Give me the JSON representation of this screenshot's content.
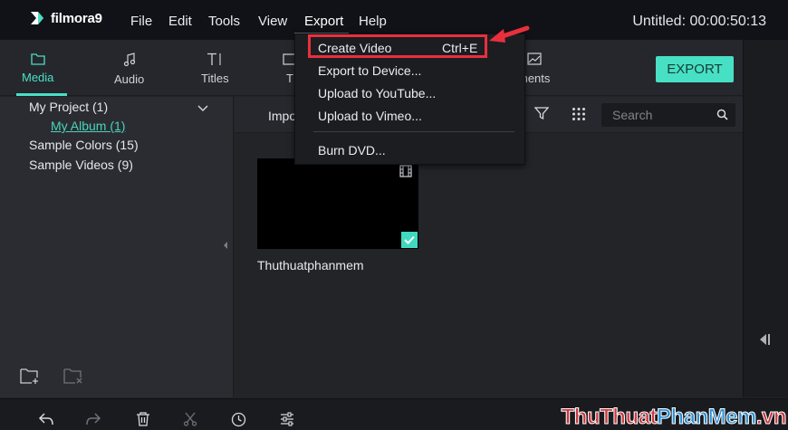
{
  "app": {
    "logo_text": "filmora9",
    "window_title": "Untitled: 00:00:50:13"
  },
  "menubar": {
    "items": [
      "File",
      "Edit",
      "Tools",
      "View",
      "Export",
      "Help"
    ]
  },
  "tabs": [
    {
      "label": "Media",
      "icon": "folder-icon"
    },
    {
      "label": "Audio",
      "icon": "music-note-icon"
    },
    {
      "label": "Titles",
      "icon": "text-icon"
    },
    {
      "label": "T",
      "icon": "transition-icon"
    },
    {
      "label": "ments",
      "icon": "elements-icon"
    }
  ],
  "export_button": "EXPORT",
  "library": {
    "project": "My Project (1)",
    "album": "My Album (1)",
    "sample_colors": "Sample Colors (15)",
    "sample_videos": "Sample Videos (9)"
  },
  "content": {
    "import_label": "Impo",
    "search_placeholder": "Search",
    "clip_name": "Thuthuatphanmem"
  },
  "export_menu": {
    "items": [
      {
        "label": "Create Video",
        "shortcut": "Ctrl+E"
      },
      {
        "label": "Export to Device..."
      },
      {
        "label": "Upload to YouTube..."
      },
      {
        "label": "Upload to Vimeo..."
      },
      {
        "label": "Burn DVD..."
      }
    ]
  },
  "watermark": {
    "part1": "ThuThuat",
    "part2": "PhanMem",
    "part3": ".vn"
  },
  "colors": {
    "accent": "#47e0c4",
    "highlight": "#e8303c",
    "menubar_bg": "#111217",
    "panel_bg": "#2b2c31"
  }
}
